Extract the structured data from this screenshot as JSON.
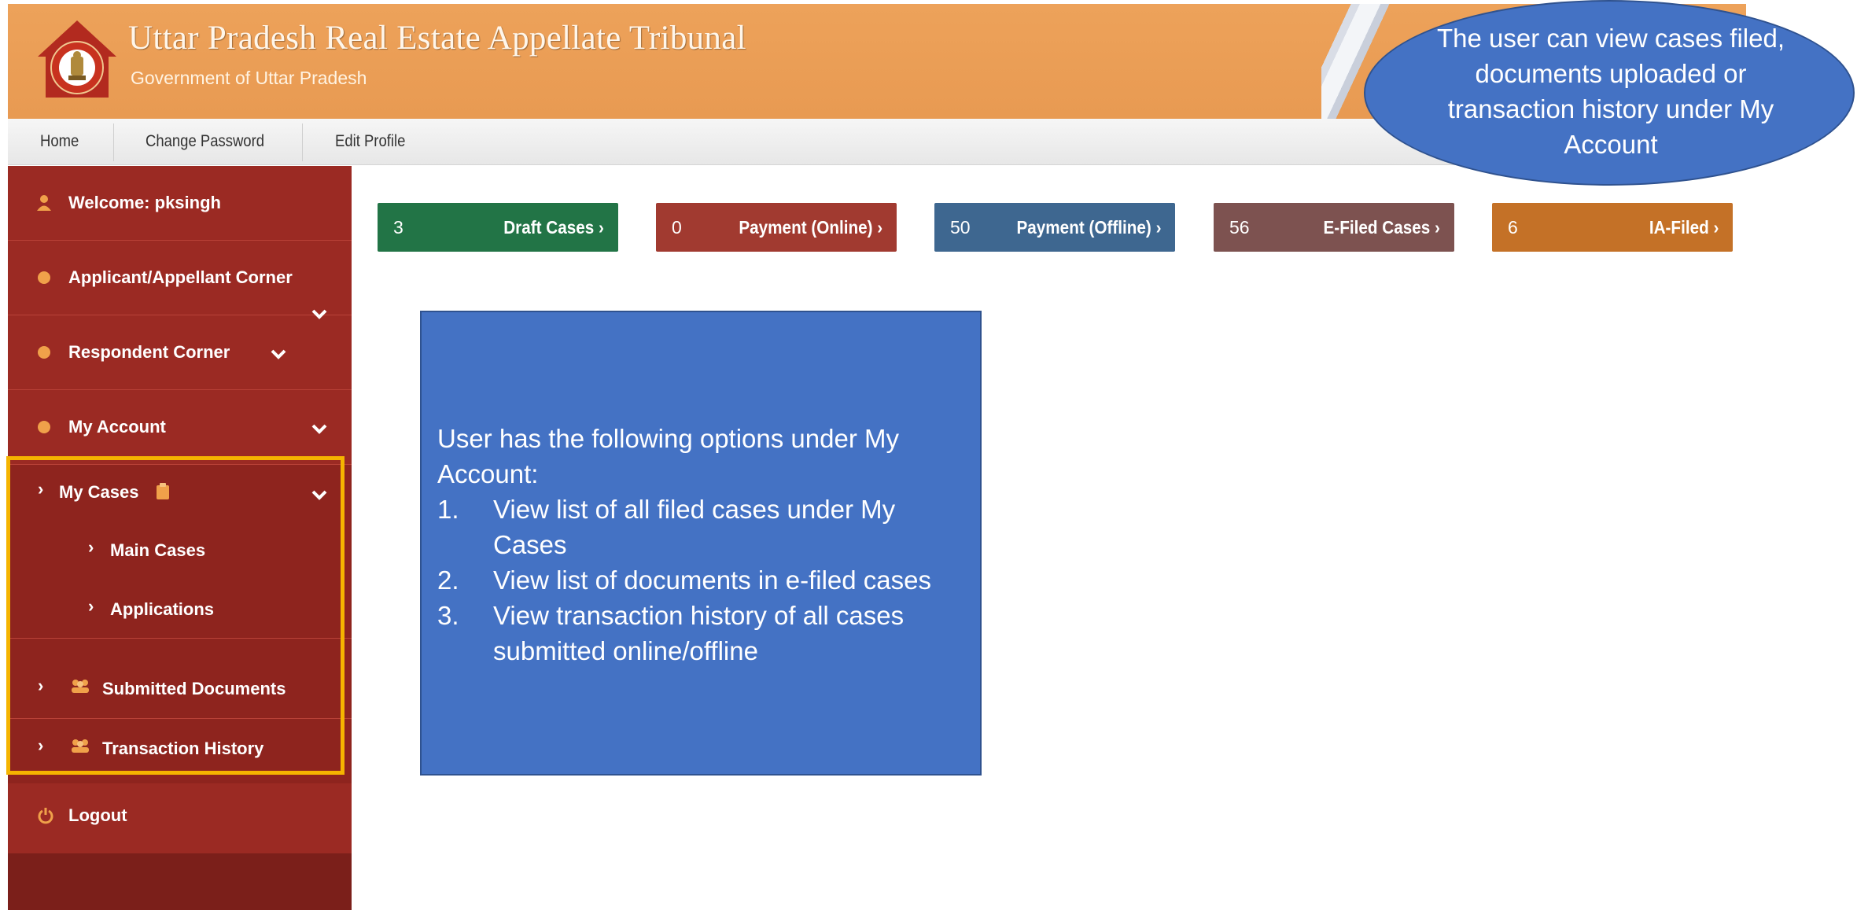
{
  "header": {
    "title": "Uttar Pradesh Real Estate Appellate Tribunal",
    "subtitle": "Government of Uttar Pradesh",
    "brand_color": "#e89a52"
  },
  "topnav": {
    "items": [
      {
        "label": "Home"
      },
      {
        "label": "Change Password"
      },
      {
        "label": "Edit Profile"
      }
    ]
  },
  "sidebar": {
    "welcome": "Welcome: pksingh",
    "items": [
      {
        "label": "Applicant/Appellant Corner",
        "icon": "circle-icon"
      },
      {
        "label": "Respondent Corner",
        "icon": "circle-icon"
      },
      {
        "label": "My Account",
        "icon": "circle-icon"
      }
    ],
    "my_cases": {
      "label": "My Cases",
      "icon": "clipboard-icon"
    },
    "my_cases_children": [
      {
        "label": "Main Cases"
      },
      {
        "label": "Applications"
      }
    ],
    "submitted_documents": {
      "label": "Submitted Documents",
      "icon": "users-icon"
    },
    "transaction_history": {
      "label": "Transaction History",
      "icon": "users-icon"
    },
    "logout": {
      "label": "Logout",
      "icon": "power-icon"
    },
    "background_color": "#9b2a23",
    "highlight_color": "#f5b400"
  },
  "stats": [
    {
      "count": "3",
      "label": "Draft Cases ›",
      "color": "#227446"
    },
    {
      "count": "0",
      "label": "Payment (Online) ›",
      "color": "#a13a30"
    },
    {
      "count": "50",
      "label": "Payment (Offline) ›",
      "color": "#3e6790"
    },
    {
      "count": "56",
      "label": "E-Filed Cases ›",
      "color": "#7d5250"
    },
    {
      "count": "6",
      "label": "IA-Filed ›",
      "color": "#c47127"
    }
  ],
  "info_box": {
    "intro": "User has the following options under My Account:",
    "options": [
      {
        "num": "1.",
        "text": "View list of all filed cases under My Cases"
      },
      {
        "num": "2.",
        "text": "View list of documents in e-filed cases"
      },
      {
        "num": "3.",
        "text": "View transaction history of all cases submitted online/offline"
      }
    ],
    "color": "#4472c4"
  },
  "callout": {
    "text": "The user can view cases filed, documents uploaded or transaction history under My Account"
  }
}
